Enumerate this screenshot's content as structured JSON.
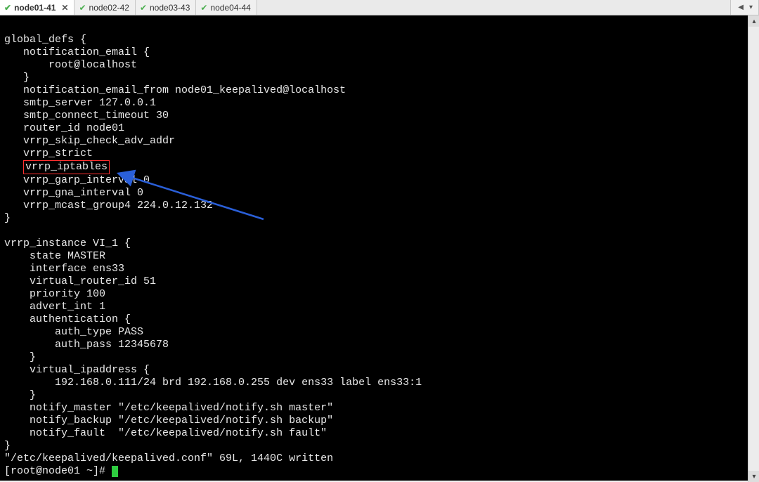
{
  "tabs": [
    {
      "label": "node01-41",
      "active": true,
      "closeable": true
    },
    {
      "label": "node02-42",
      "active": false,
      "closeable": false
    },
    {
      "label": "node03-43",
      "active": false,
      "closeable": false
    },
    {
      "label": "node04-44",
      "active": false,
      "closeable": false
    }
  ],
  "highlighted_directive": "vrrp_iptables",
  "config_lines": [
    "",
    "global_defs {",
    "   notification_email {",
    "       root@localhost",
    "   }",
    "   notification_email_from node01_keepalived@localhost",
    "   smtp_server 127.0.0.1",
    "   smtp_connect_timeout 30",
    "   router_id node01",
    "   vrrp_skip_check_adv_addr",
    "   vrrp_strict",
    "   vrrp_iptables",
    "   vrrp_garp_interval 0",
    "   vrrp_gna_interval 0",
    "   vrrp_mcast_group4 224.0.12.132",
    "}",
    "",
    "vrrp_instance VI_1 {",
    "    state MASTER",
    "    interface ens33",
    "    virtual_router_id 51",
    "    priority 100",
    "    advert_int 1",
    "    authentication {",
    "        auth_type PASS",
    "        auth_pass 12345678",
    "    }",
    "    virtual_ipaddress {",
    "        192.168.0.111/24 brd 192.168.0.255 dev ens33 label ens33:1",
    "    }",
    "    notify_master \"/etc/keepalived/notify.sh master\"",
    "    notify_backup \"/etc/keepalived/notify.sh backup\"",
    "    notify_fault  \"/etc/keepalived/notify.sh fault\"",
    "}"
  ],
  "status_line": "\"/etc/keepalived/keepalived.conf\" 69L, 1440C written",
  "prompt": "[root@node01 ~]# ",
  "colors": {
    "bg": "#000000",
    "fg": "#e8e8e8",
    "highlight_border": "#ff3030",
    "arrow": "#2a5fd8",
    "cursor": "#2ecc40",
    "tab_check": "#4caf50"
  }
}
